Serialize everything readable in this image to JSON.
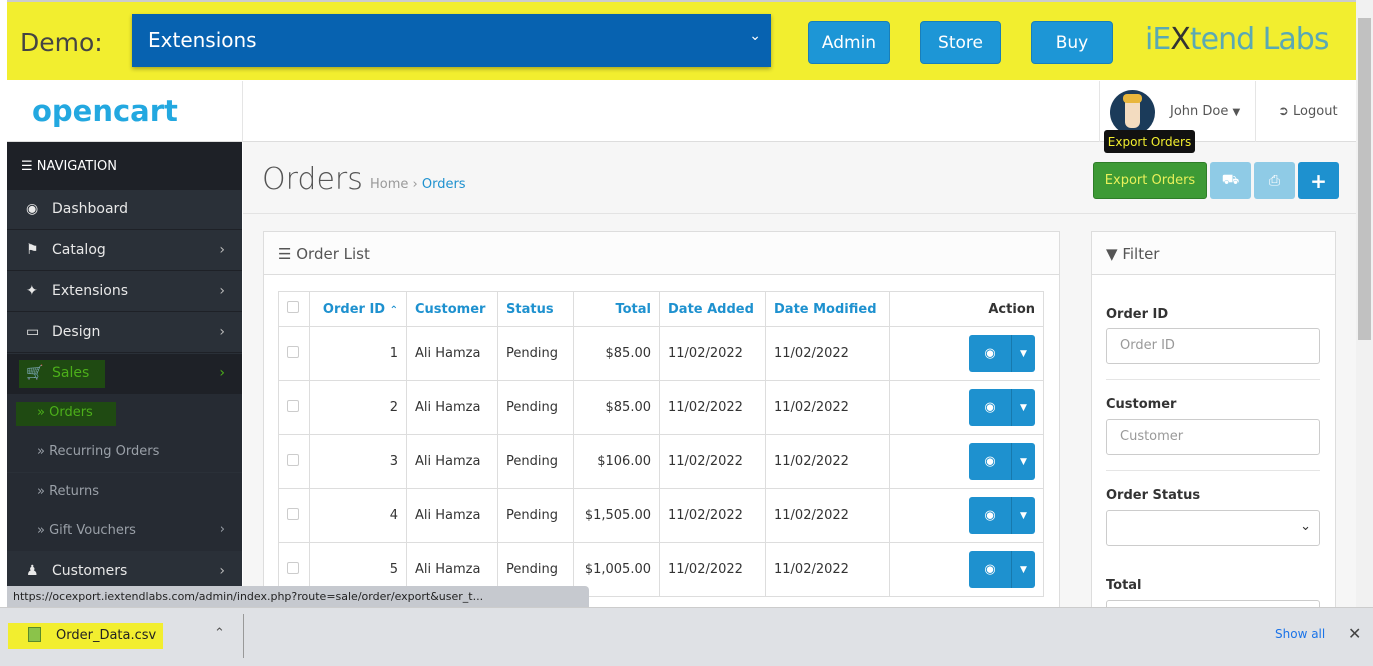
{
  "topbar": {
    "demo_label": "Demo:",
    "select_value": "Extensions",
    "buttons": [
      "Admin",
      "Store",
      "Buy"
    ],
    "logo": "iEXtend Labs"
  },
  "header": {
    "logo": "opencart",
    "user": "John Doe",
    "logout": "Logout"
  },
  "nav": {
    "title": "NAVIGATION",
    "items": [
      {
        "label": "Dashboard",
        "icon": "dashboard-icon"
      },
      {
        "label": "Catalog",
        "icon": "tag-icon"
      },
      {
        "label": "Extensions",
        "icon": "puzzle-icon"
      },
      {
        "label": "Design",
        "icon": "desktop-icon"
      },
      {
        "label": "Sales",
        "icon": "cart-icon"
      }
    ],
    "sub": [
      "Orders",
      "Recurring Orders",
      "Returns",
      "Gift Vouchers"
    ],
    "customers": "Customers"
  },
  "page": {
    "title": "Orders",
    "breadcrumb": [
      "Home",
      "Orders"
    ],
    "export_label": "Export Orders",
    "tooltip": "Export Orders"
  },
  "orders": {
    "title": "Order List",
    "columns": [
      "Order ID",
      "Customer",
      "Status",
      "Total",
      "Date Added",
      "Date Modified",
      "Action"
    ],
    "rows": [
      {
        "id": "1",
        "customer": "Ali Hamza",
        "status": "Pending",
        "total": "$85.00",
        "added": "11/02/2022",
        "modified": "11/02/2022"
      },
      {
        "id": "2",
        "customer": "Ali Hamza",
        "status": "Pending",
        "total": "$85.00",
        "added": "11/02/2022",
        "modified": "11/02/2022"
      },
      {
        "id": "3",
        "customer": "Ali Hamza",
        "status": "Pending",
        "total": "$106.00",
        "added": "11/02/2022",
        "modified": "11/02/2022"
      },
      {
        "id": "4",
        "customer": "Ali Hamza",
        "status": "Pending",
        "total": "$1,505.00",
        "added": "11/02/2022",
        "modified": "11/02/2022"
      },
      {
        "id": "5",
        "customer": "Ali Hamza",
        "status": "Pending",
        "total": "$1,005.00",
        "added": "11/02/2022",
        "modified": "11/02/2022"
      }
    ]
  },
  "filter": {
    "title": "Filter",
    "order_id_label": "Order ID",
    "order_id_placeholder": "Order ID",
    "customer_label": "Customer",
    "customer_placeholder": "Customer",
    "status_label": "Order Status",
    "total_label": "Total"
  },
  "browser": {
    "status_url": "https://ocexport.iextendlabs.com/admin/index.php?route=sale/order/export&user_t...",
    "download_file": "Order_Data.csv",
    "show_all": "Show all"
  },
  "colors": {
    "highlight": "#f2ee2f",
    "primary": "#1e91cf",
    "export": "#3d9a35"
  }
}
